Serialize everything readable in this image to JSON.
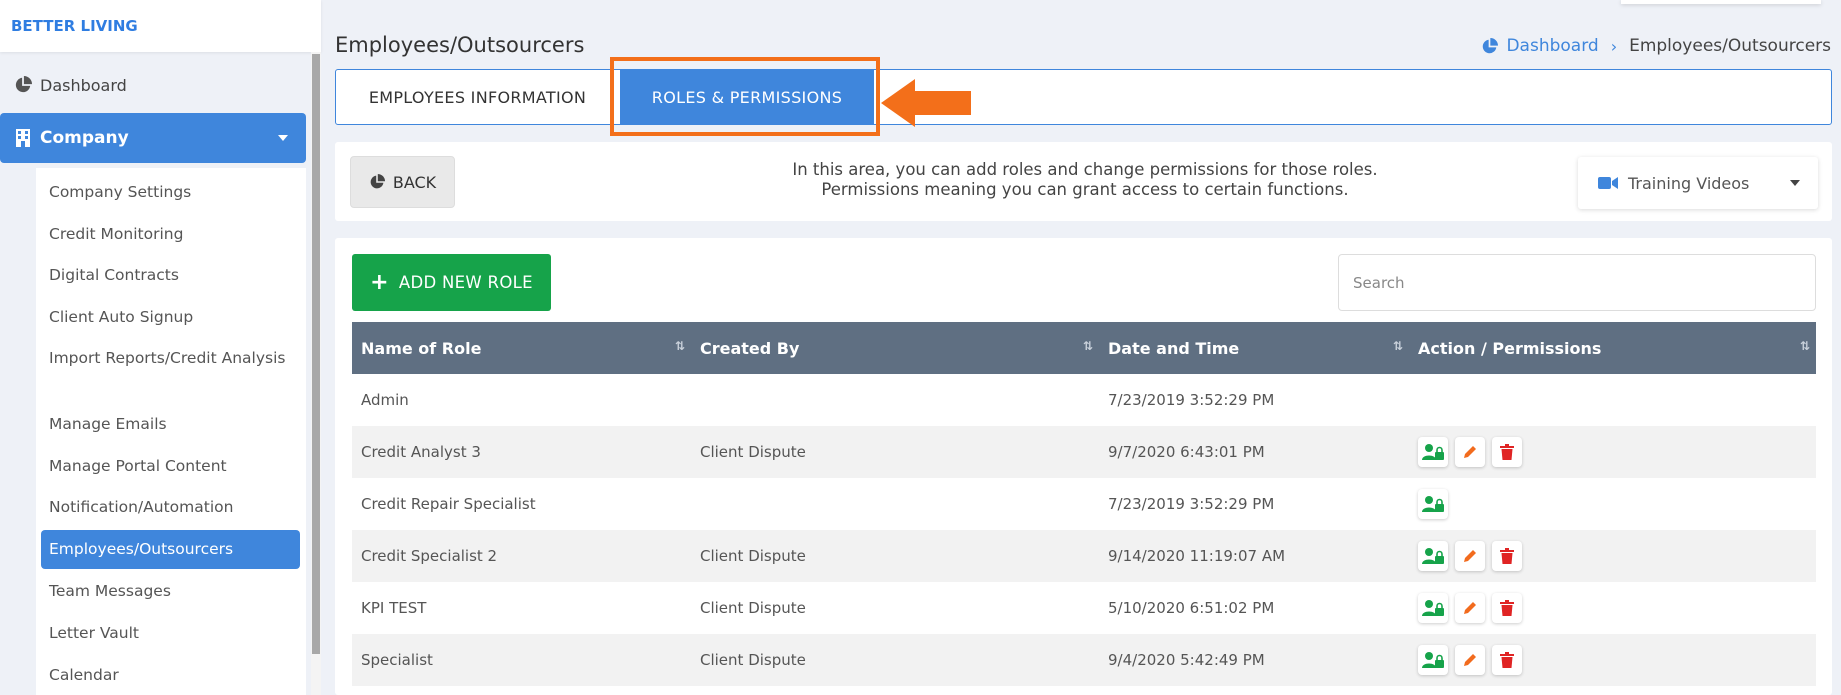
{
  "brand": "BETTER LIVING",
  "sidebar": {
    "dashboard": "Dashboard",
    "company": "Company",
    "submenu": [
      "Company Settings",
      "Credit Monitoring",
      "Digital Contracts",
      "Client Auto Signup",
      "Import Reports/Credit Analysis",
      "Manage Emails",
      "Manage Portal Content",
      "Notification/Automation",
      "Employees/Outsourcers",
      "Team Messages",
      "Letter Vault",
      "Calendar"
    ],
    "active_item": "Employees/Outsourcers"
  },
  "header": {
    "title": "Employees/Outsourcers",
    "breadcrumb": {
      "home": "Dashboard",
      "current": "Employees/Outsourcers"
    }
  },
  "tabs": [
    {
      "label": "EMPLOYEES INFORMATION",
      "active": false
    },
    {
      "label": "ROLES & PERMISSIONS",
      "active": true
    }
  ],
  "info": {
    "back_label": "BACK",
    "line1": "In this area, you can add roles and change permissions for those roles.",
    "line2": "Permissions meaning you can grant access to certain functions.",
    "training_label": "Training Videos"
  },
  "roles": {
    "add_label": "ADD NEW ROLE",
    "search_placeholder": "Search",
    "columns": [
      "Name of Role",
      "Created By",
      "Date and Time",
      "Action / Permissions"
    ],
    "rows": [
      {
        "name": "Admin",
        "created_by": "",
        "datetime": "7/23/2019 3:52:29 PM",
        "actions": []
      },
      {
        "name": "Credit Analyst 3",
        "created_by": "Client Dispute",
        "datetime": "9/7/2020 6:43:01 PM",
        "actions": [
          "permissions",
          "edit",
          "delete"
        ]
      },
      {
        "name": "Credit Repair Specialist",
        "created_by": "",
        "datetime": "7/23/2019 3:52:29 PM",
        "actions": [
          "permissions"
        ]
      },
      {
        "name": "Credit Specialist 2",
        "created_by": "Client Dispute",
        "datetime": "9/14/2020 11:19:07 AM",
        "actions": [
          "permissions",
          "edit",
          "delete"
        ]
      },
      {
        "name": "KPI TEST",
        "created_by": "Client Dispute",
        "datetime": "5/10/2020 6:51:02 PM",
        "actions": [
          "permissions",
          "edit",
          "delete"
        ]
      },
      {
        "name": "Specialist",
        "created_by": "Client Dispute",
        "datetime": "9/4/2020 5:42:49 PM",
        "actions": [
          "permissions",
          "edit",
          "delete"
        ]
      }
    ]
  },
  "colors": {
    "primary": "#3f86dc",
    "success": "#16a34a",
    "header_bg": "#5f6f82",
    "highlight": "#f36f1a",
    "edit": "#f26b1d",
    "delete": "#e02424"
  }
}
